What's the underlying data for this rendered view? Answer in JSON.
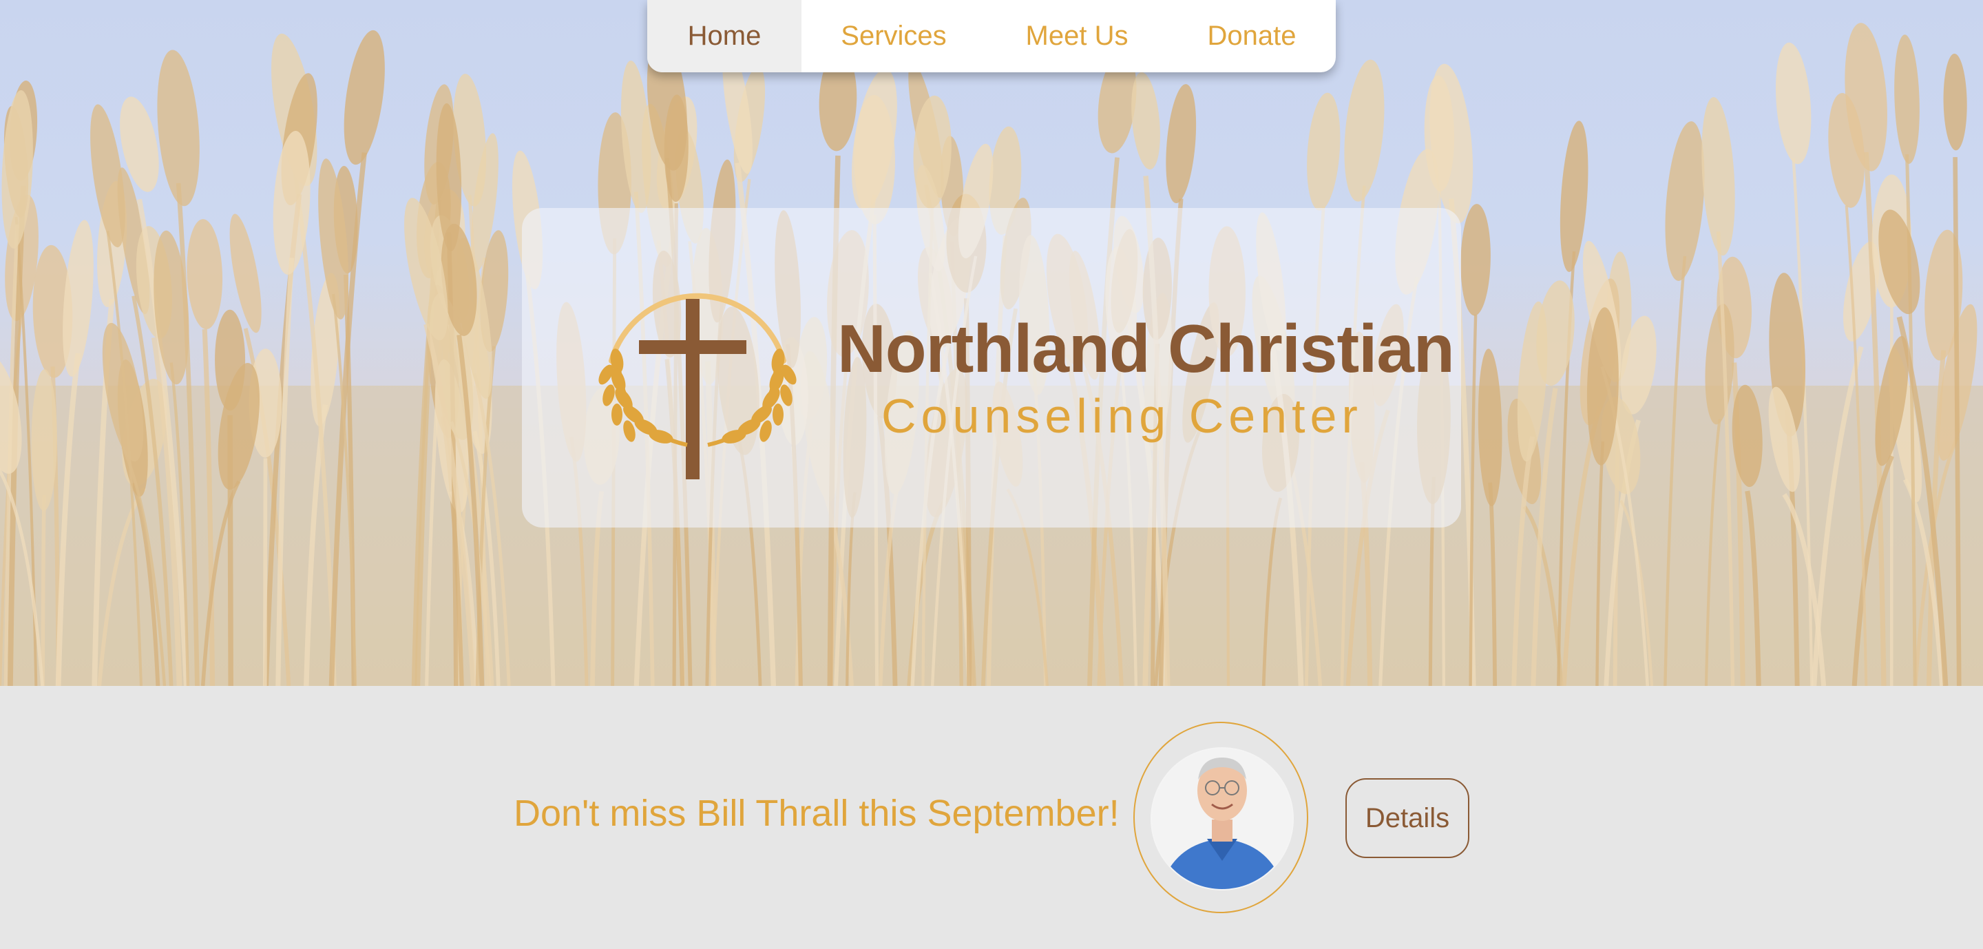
{
  "nav": {
    "items": [
      {
        "label": "Home",
        "active": true
      },
      {
        "label": "Services",
        "active": false
      },
      {
        "label": "Meet Us",
        "active": false
      },
      {
        "label": "Donate",
        "active": false
      }
    ]
  },
  "hero": {
    "background": "wheat-field-photo",
    "logo": {
      "title": "Northland Christian",
      "subtitle": "Counseling Center",
      "emblem": "cross-with-wheat-wreath-icon"
    }
  },
  "promo": {
    "text": "Don't miss Bill Thrall this September!",
    "photo": "speaker-portrait",
    "button_label": "Details"
  },
  "colors": {
    "brand_gold": "#e0a53c",
    "brand_brown": "#8a5a35",
    "page_gray": "#e6e6e6",
    "sky": "#c9d5ef"
  }
}
